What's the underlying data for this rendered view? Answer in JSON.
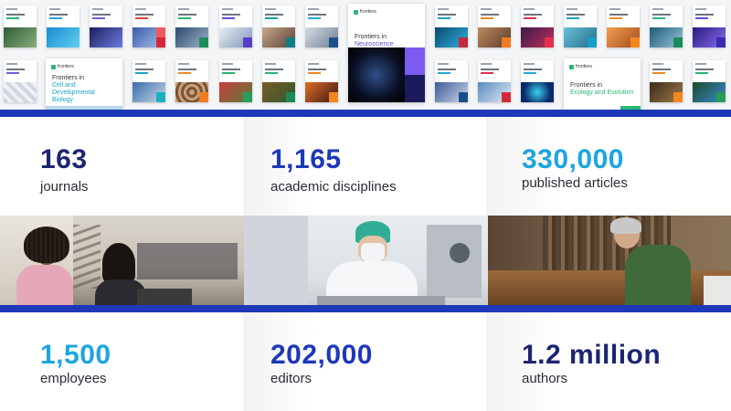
{
  "colors": {
    "accent_blue": "#1d38b8",
    "navy": "#1c2570",
    "light_blue": "#1da5e0"
  },
  "featured_covers": [
    {
      "name": "Frontiers in",
      "subject": "Neuroscience"
    },
    {
      "name": "Frontiers in",
      "subject": "Cell and Developmental Biology"
    },
    {
      "name": "Frontiers in",
      "subject": "Ecology and Evolution"
    }
  ],
  "brand": "frontiers",
  "stats": [
    {
      "value": "163",
      "label": "journals",
      "color": "#1c2570"
    },
    {
      "value": "1,165",
      "label": "academic disciplines",
      "color": "#1d38b8"
    },
    {
      "value": "330,000",
      "label": "published articles",
      "color": "#1da5e0"
    },
    {
      "value": "1,500",
      "label": "employees",
      "color": "#1da5e0"
    },
    {
      "value": "202,000",
      "label": "editors",
      "color": "#1d38b8"
    },
    {
      "value": "1.2 million",
      "label": "authors",
      "color": "#1c2570"
    }
  ]
}
